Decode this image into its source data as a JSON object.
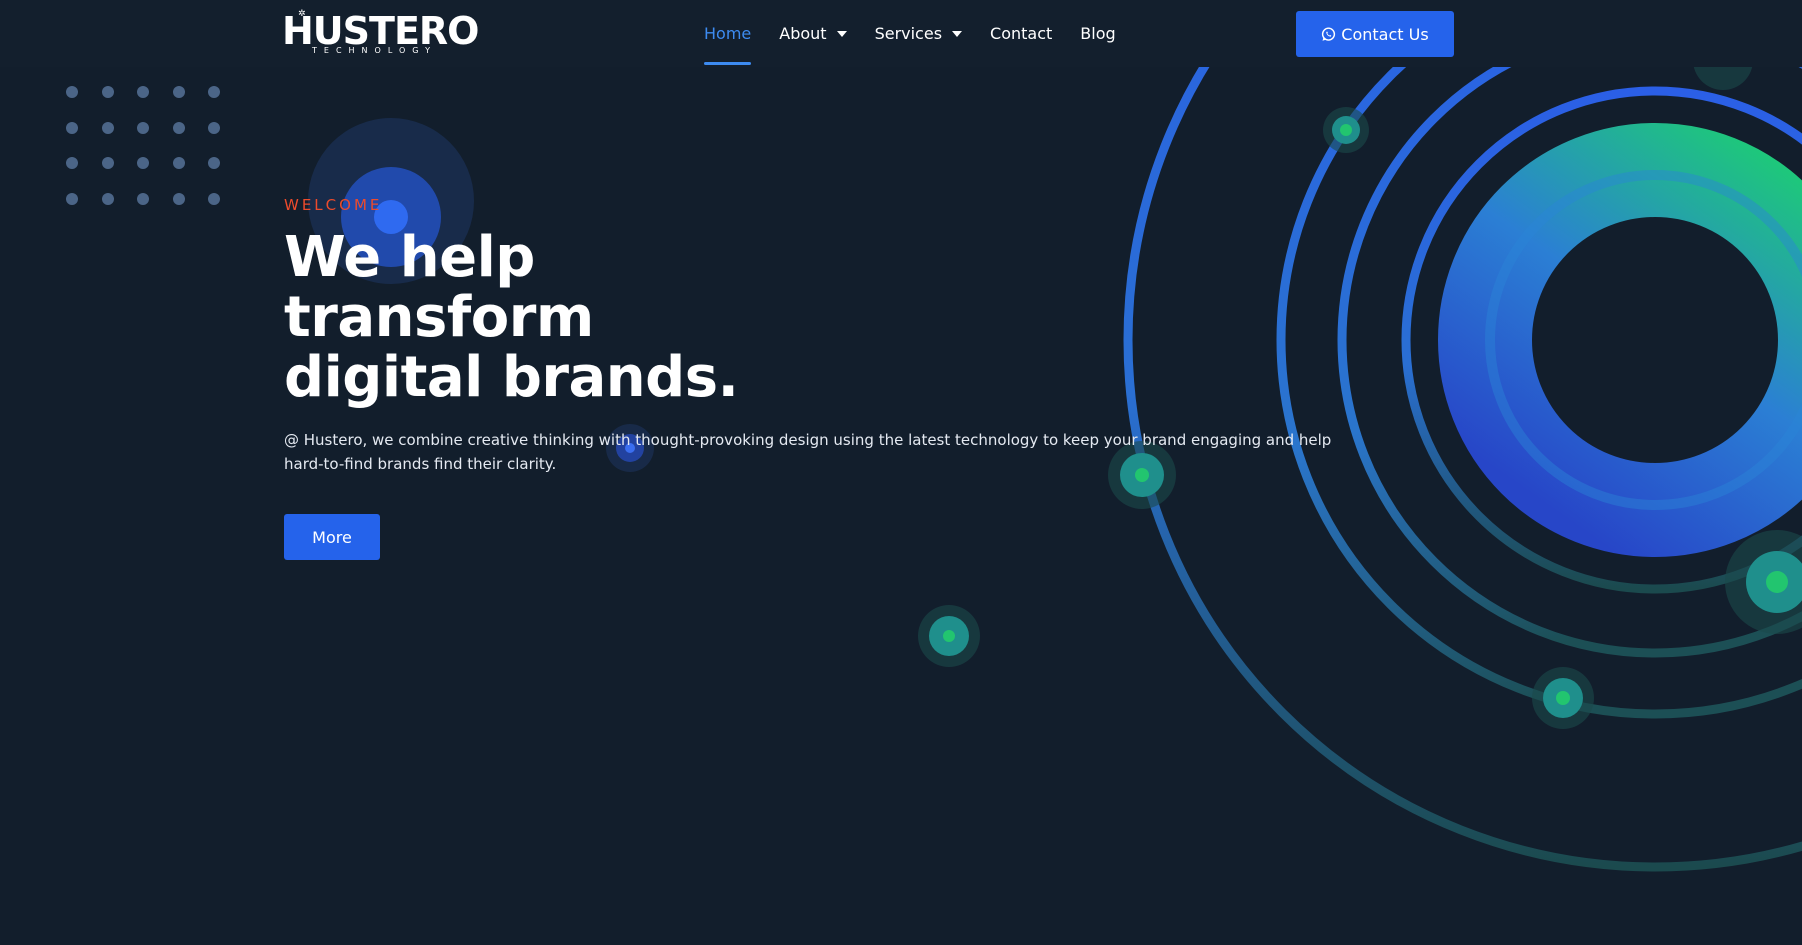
{
  "brand": {
    "name": "HUSTERO",
    "tagline": "TECHNOLOGY",
    "logo_mark": "✲"
  },
  "nav": {
    "items": [
      {
        "label": "Home",
        "active": true,
        "has_dropdown": false
      },
      {
        "label": "About",
        "active": false,
        "has_dropdown": true
      },
      {
        "label": "Services",
        "active": false,
        "has_dropdown": true
      },
      {
        "label": "Contact",
        "active": false,
        "has_dropdown": false
      },
      {
        "label": "Blog",
        "active": false,
        "has_dropdown": false
      }
    ]
  },
  "header": {
    "cta_label": "Contact Us",
    "cta_icon": "whatsapp-icon"
  },
  "hero": {
    "eyebrow": "WELCOME",
    "headline_lines": [
      "We help",
      "transform",
      "digital brands."
    ],
    "description": "@ Hustero, we combine creative thinking with thought-provoking design using the latest technology to keep your brand engaging and help hard-to-find brands find their clarity.",
    "button_label": "More"
  },
  "colors": {
    "background": "#121e2c",
    "accent": "#2563eb",
    "nav_active": "#3d8bf0",
    "eyebrow": "#ec4b2c",
    "ring_blue": "#2a63e8",
    "ring_green": "#1ec87a",
    "dot_grid": "#4b6587"
  }
}
